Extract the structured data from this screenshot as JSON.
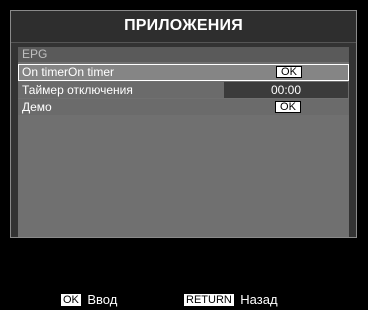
{
  "title": "ПРИЛОЖЕНИЯ",
  "section": "EPG",
  "rows": [
    {
      "label": "On timerOn timer",
      "value": "OK",
      "selected": true
    },
    {
      "label": "Таймер отключения",
      "value": "00:00"
    },
    {
      "label": "Демо",
      "value": "OK"
    }
  ],
  "footer": {
    "ok_key": "OK",
    "ok_label": "Ввод",
    "return_key": "RETURN",
    "return_label": "Назад"
  }
}
